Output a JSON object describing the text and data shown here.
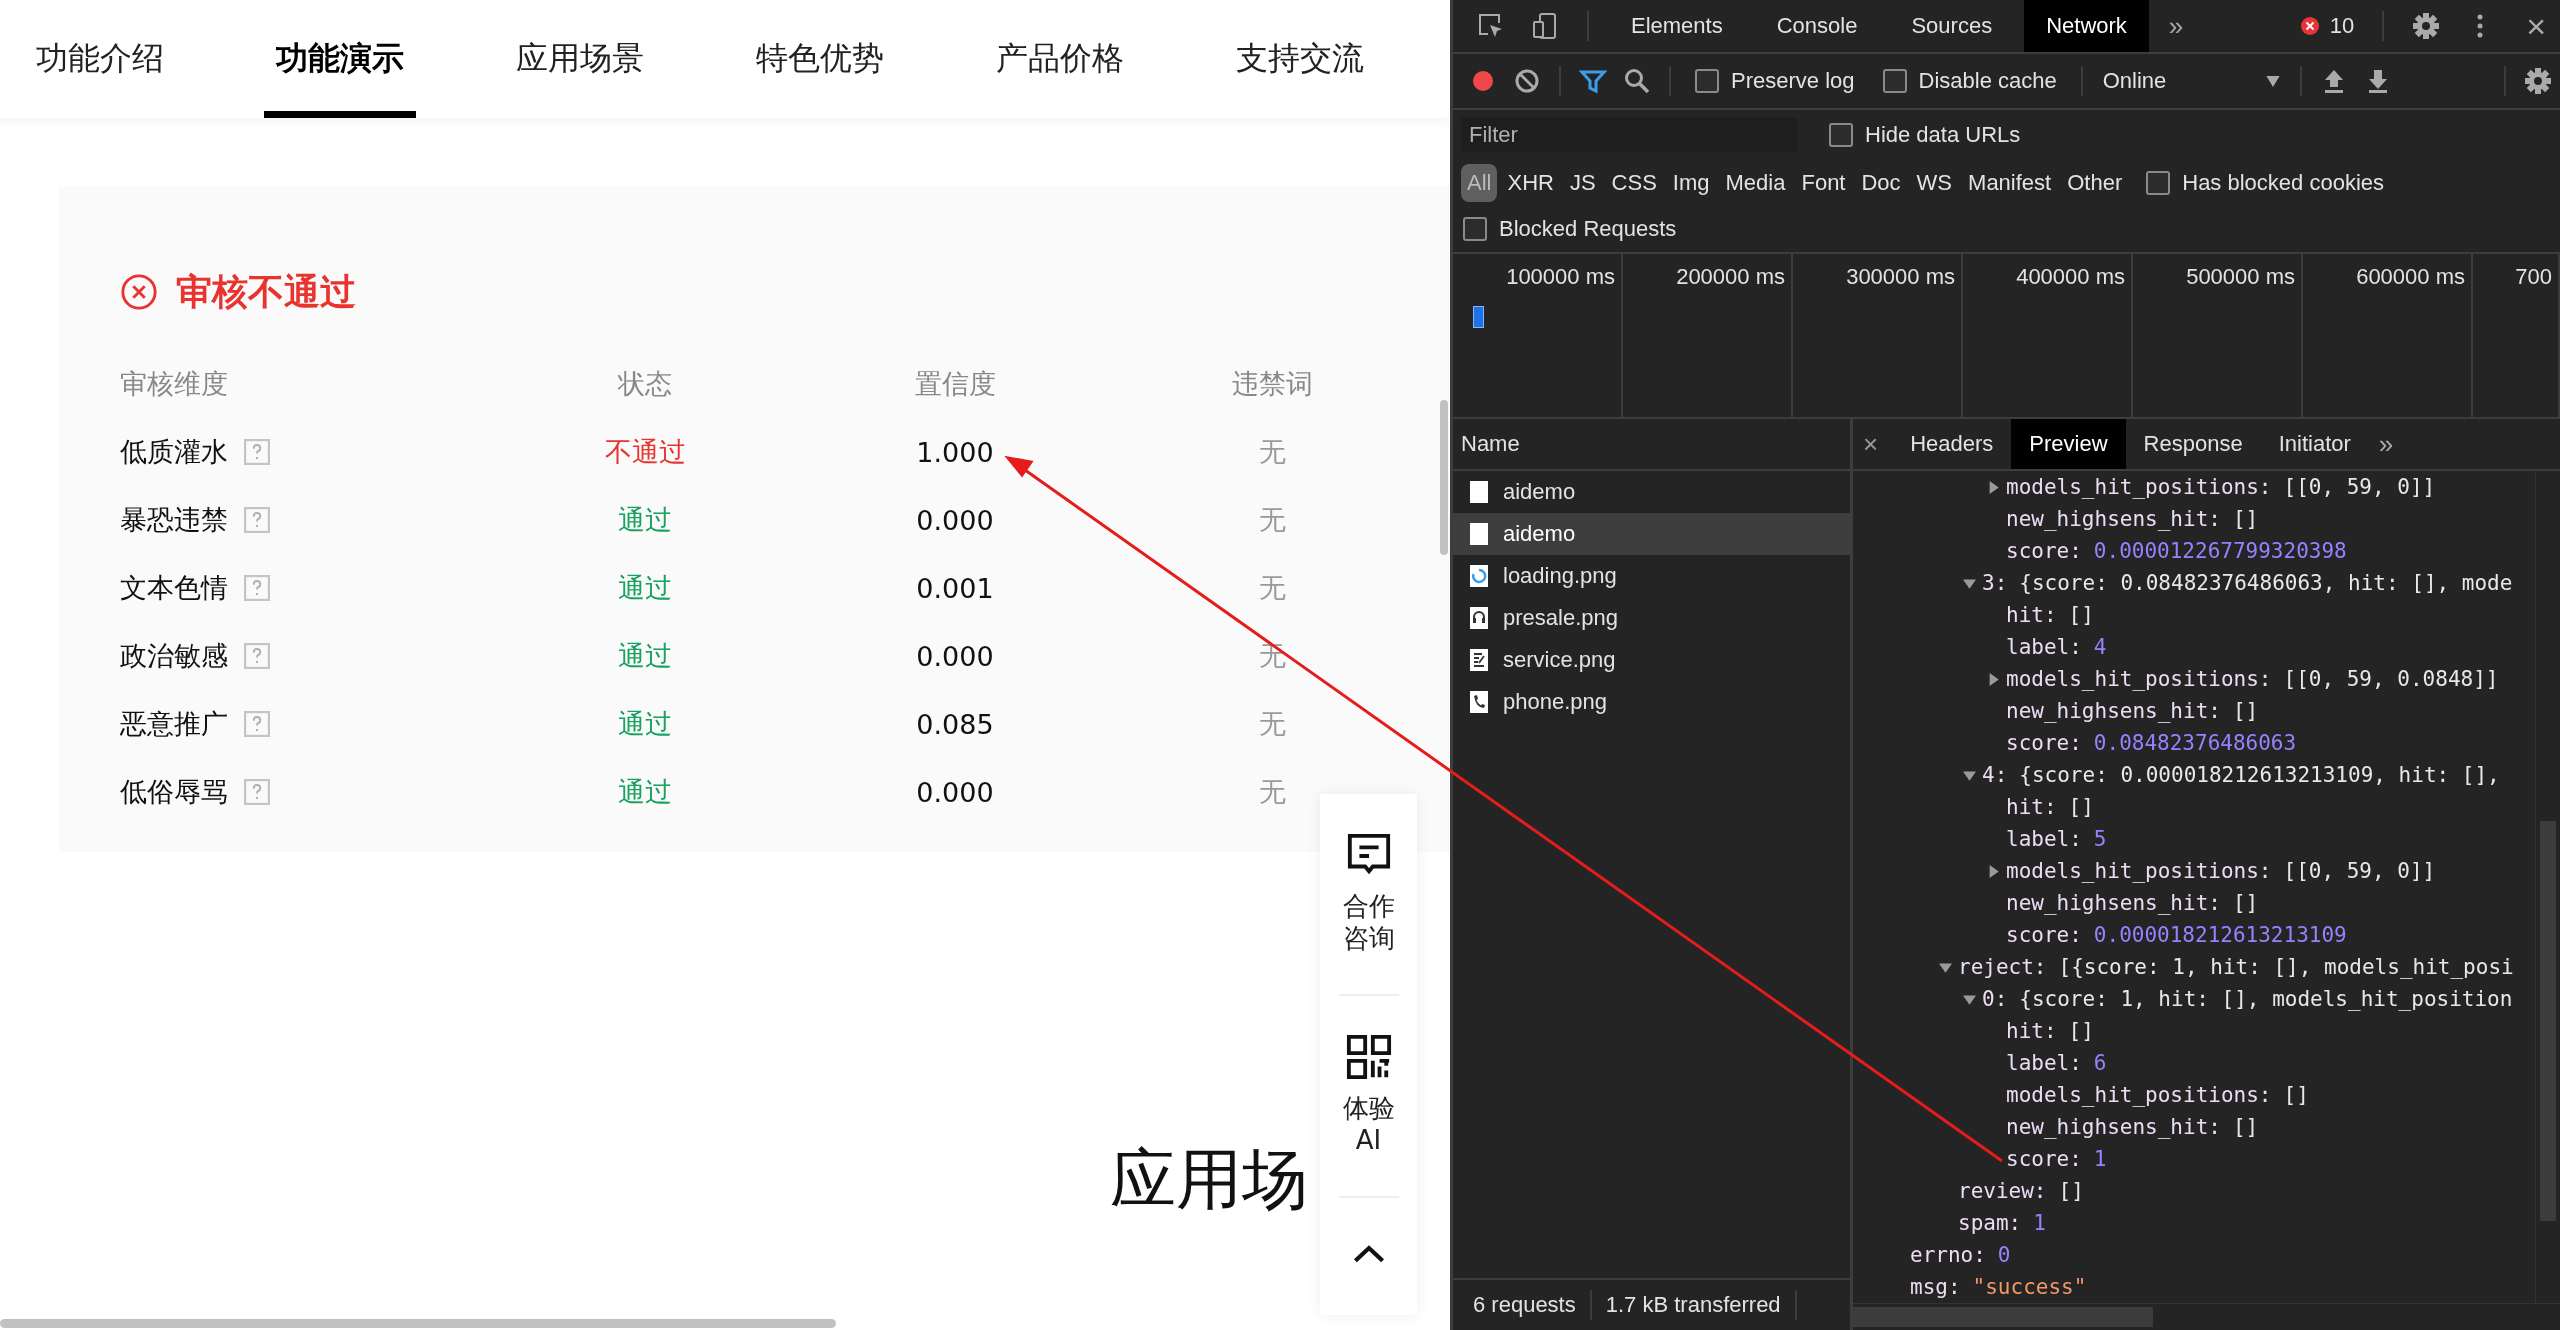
{
  "nav": {
    "tabs": [
      {
        "label": "功能介绍",
        "selected": false
      },
      {
        "label": "功能演示",
        "selected": true
      },
      {
        "label": "应用场景",
        "selected": false
      },
      {
        "label": "特色优势",
        "selected": false
      },
      {
        "label": "产品价格",
        "selected": false
      },
      {
        "label": "支持交流",
        "selected": false
      }
    ]
  },
  "result": {
    "title": "审核不通过",
    "passed": false,
    "columns": [
      "审核维度",
      "状态",
      "置信度",
      "违禁词"
    ],
    "rows": [
      {
        "dimension": "低质灌水",
        "status": "不通过",
        "passed": false,
        "confidence": "1.000",
        "banned": "无"
      },
      {
        "dimension": "暴恐违禁",
        "status": "通过",
        "passed": true,
        "confidence": "0.000",
        "banned": "无"
      },
      {
        "dimension": "文本色情",
        "status": "通过",
        "passed": true,
        "confidence": "0.001",
        "banned": "无"
      },
      {
        "dimension": "政治敏感",
        "status": "通过",
        "passed": true,
        "confidence": "0.000",
        "banned": "无"
      },
      {
        "dimension": "恶意推广",
        "status": "通过",
        "passed": true,
        "confidence": "0.085",
        "banned": "无"
      },
      {
        "dimension": "低俗辱骂",
        "status": "通过",
        "passed": true,
        "confidence": "0.000",
        "banned": "无"
      }
    ]
  },
  "section_heading": "应用场",
  "float_bar": {
    "items": [
      {
        "kind": "chat",
        "label": "合作咨询"
      },
      {
        "kind": "qr",
        "label": "体验AI"
      },
      {
        "kind": "top"
      }
    ]
  },
  "devtools": {
    "tabs": [
      {
        "label": "Elements",
        "selected": false
      },
      {
        "label": "Console",
        "selected": false
      },
      {
        "label": "Sources",
        "selected": false
      },
      {
        "label": "Network",
        "selected": true
      }
    ],
    "more": "»",
    "error_count": "10",
    "close": "×",
    "toolbar": {
      "recording": true,
      "filter_active": true,
      "checkboxes": [
        {
          "label": "Preserve log",
          "checked": false
        },
        {
          "label": "Disable cache",
          "checked": false
        }
      ],
      "throttling": "Online"
    },
    "filter": {
      "placeholder": "Filter",
      "hide_data_urls": {
        "label": "Hide data URLs",
        "checked": false
      }
    },
    "types": [
      {
        "label": "All",
        "selected": true
      },
      {
        "label": "XHR",
        "selected": false
      },
      {
        "label": "JS",
        "selected": false
      },
      {
        "label": "CSS",
        "selected": false
      },
      {
        "label": "Img",
        "selected": false
      },
      {
        "label": "Media",
        "selected": false
      },
      {
        "label": "Font",
        "selected": false
      },
      {
        "label": "Doc",
        "selected": false
      },
      {
        "label": "WS",
        "selected": false
      },
      {
        "label": "Manifest",
        "selected": false
      },
      {
        "label": "Other",
        "selected": false
      }
    ],
    "has_blocked_cookies": {
      "label": "Has blocked cookies",
      "checked": false
    },
    "blocked_requests": {
      "label": "Blocked Requests",
      "checked": false
    },
    "timeline": {
      "ticks": [
        "100000 ms",
        "200000 ms",
        "300000 ms",
        "400000 ms",
        "500000 ms",
        "600000 ms",
        "700"
      ]
    },
    "requests": {
      "column": "Name",
      "rows": [
        {
          "name": "aidemo",
          "kind": "doc",
          "selected": false
        },
        {
          "name": "aidemo",
          "kind": "doc",
          "selected": true
        },
        {
          "name": "loading.png",
          "kind": "spinner",
          "selected": false
        },
        {
          "name": "presale.png",
          "kind": "headset",
          "selected": false
        },
        {
          "name": "service.png",
          "kind": "form",
          "selected": false
        },
        {
          "name": "phone.png",
          "kind": "phone",
          "selected": false
        }
      ]
    },
    "detail_close": "×",
    "detail_tabs": [
      {
        "label": "Headers",
        "selected": false
      },
      {
        "label": "Preview",
        "selected": true
      },
      {
        "label": "Response",
        "selected": false
      },
      {
        "label": "Initiator",
        "selected": false
      }
    ],
    "detail_more": "»",
    "preview": [
      {
        "children": [
          {
            "children": [
              {
                "children": [
                  {
                    "children": [
                      {
                        "key": "models_hit_positions:",
                        "value": "[[0, 59, 0]]",
                        "kind": "plain",
                        "expanded": false
                      },
                      {
                        "key": "new_highsens_hit:",
                        "value": "[]",
                        "kind": "plain"
                      },
                      {
                        "key": "score:",
                        "value": "0.000012267799320398",
                        "kind": "number"
                      }
                    ]
                  },
                  {
                    "key": "3:",
                    "value": "{score: 0.08482376486063, hit: [], mode",
                    "kind": "plain",
                    "expanded": true,
                    "children": [
                      {
                        "key": "hit:",
                        "value": "[]",
                        "kind": "plain"
                      },
                      {
                        "key": "label:",
                        "value": "4",
                        "kind": "number"
                      },
                      {
                        "key": "models_hit_positions:",
                        "value": "[[0, 59, 0.0848]]",
                        "kind": "plain",
                        "expanded": false
                      },
                      {
                        "key": "new_highsens_hit:",
                        "value": "[]",
                        "kind": "plain"
                      },
                      {
                        "key": "score:",
                        "value": "0.08482376486063",
                        "kind": "number"
                      }
                    ]
                  },
                  {
                    "key": "4:",
                    "value": "{score: 0.000018212613213109, hit: [],",
                    "kind": "plain",
                    "expanded": true,
                    "children": [
                      {
                        "key": "hit:",
                        "value": "[]",
                        "kind": "plain"
                      },
                      {
                        "key": "label:",
                        "value": "5",
                        "kind": "number"
                      },
                      {
                        "key": "models_hit_positions:",
                        "value": "[[0, 59, 0]]",
                        "kind": "plain",
                        "expanded": false
                      },
                      {
                        "key": "new_highsens_hit:",
                        "value": "[]",
                        "kind": "plain"
                      },
                      {
                        "key": "score:",
                        "value": "0.000018212613213109",
                        "kind": "number"
                      }
                    ]
                  }
                ]
              },
              {
                "key": "reject:",
                "value": "[{score: 1, hit: [], models_hit_posi",
                "kind": "plain",
                "expanded": true,
                "children": [
                  {
                    "key": "0:",
                    "value": "{score: 1, hit: [], models_hit_position",
                    "kind": "plain",
                    "expanded": true,
                    "children": [
                      {
                        "key": "hit:",
                        "value": "[]",
                        "kind": "plain"
                      },
                      {
                        "key": "label:",
                        "value": "6",
                        "kind": "number"
                      },
                      {
                        "key": "models_hit_positions:",
                        "value": "[]",
                        "kind": "plain"
                      },
                      {
                        "key": "new_highsens_hit:",
                        "value": "[]",
                        "kind": "plain"
                      },
                      {
                        "key": "score:",
                        "value": "1",
                        "kind": "number"
                      }
                    ]
                  }
                ]
              },
              {
                "key": "review:",
                "value": "[]",
                "kind": "plain"
              },
              {
                "key": "spam:",
                "value": "1",
                "kind": "number"
              }
            ]
          }
        ]
      },
      {
        "key": "errno:",
        "value": "0",
        "kind": "number"
      },
      {
        "key": "msg:",
        "value": "\"success\"",
        "kind": "string"
      }
    ],
    "status": [
      "6 requests",
      "1.7 kB transferred"
    ]
  }
}
